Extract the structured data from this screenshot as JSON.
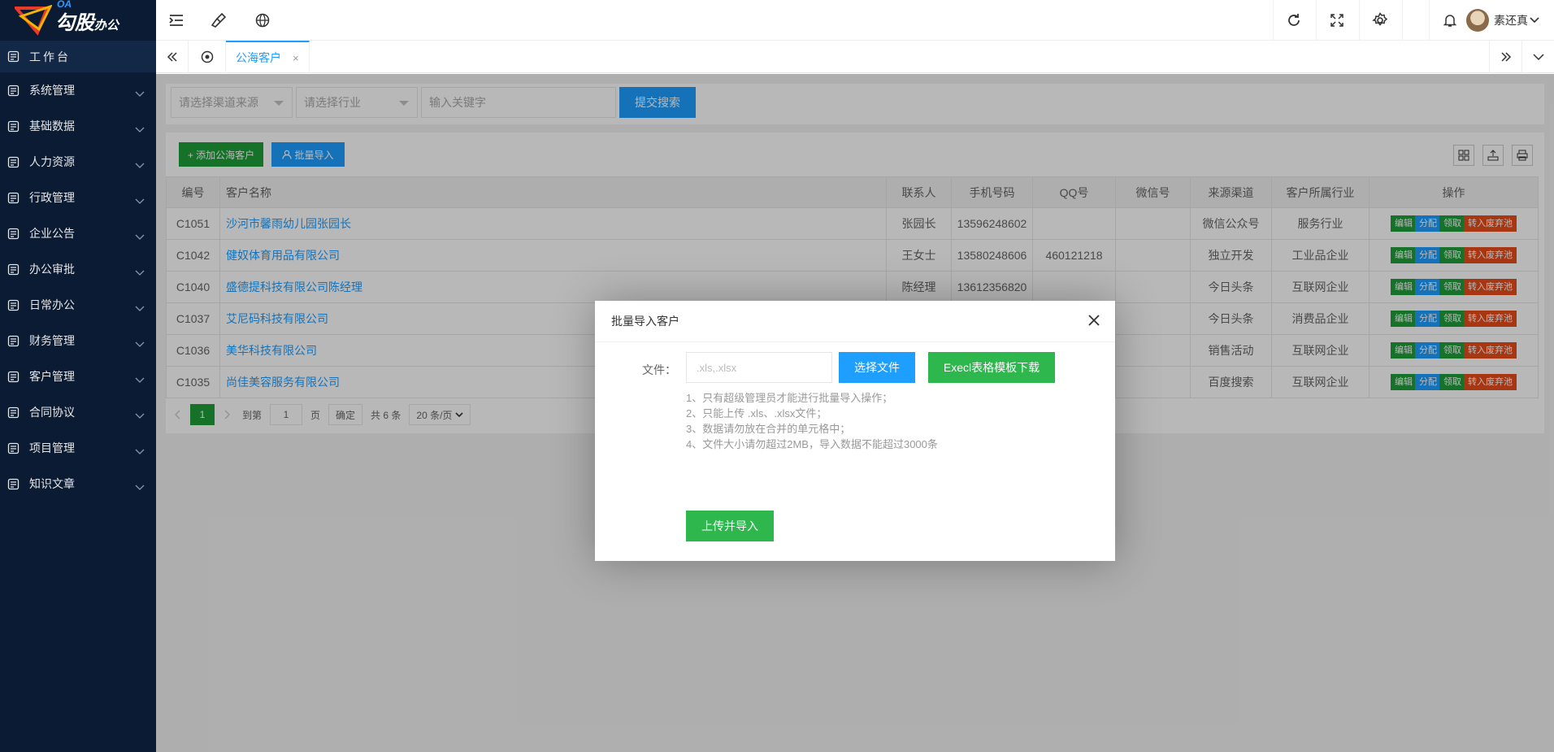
{
  "brand": {
    "oa": "OA",
    "name": "勾股",
    "suffix": "办公"
  },
  "sidebar": {
    "items": [
      {
        "label": "工作台",
        "icon": "dashboard-icon"
      },
      {
        "label": "系统管理",
        "icon": "settings-icon"
      },
      {
        "label": "基础数据",
        "icon": "data-icon"
      },
      {
        "label": "人力资源",
        "icon": "people-icon"
      },
      {
        "label": "行政管理",
        "icon": "admin-icon"
      },
      {
        "label": "企业公告",
        "icon": "bell-icon"
      },
      {
        "label": "办公审批",
        "icon": "approve-icon"
      },
      {
        "label": "日常办公",
        "icon": "calendar-icon"
      },
      {
        "label": "财务管理",
        "icon": "finance-icon"
      },
      {
        "label": "客户管理",
        "icon": "customer-icon"
      },
      {
        "label": "合同协议",
        "icon": "contract-icon"
      },
      {
        "label": "项目管理",
        "icon": "project-icon"
      },
      {
        "label": "知识文章",
        "icon": "article-icon"
      }
    ]
  },
  "topbar": {
    "user_name": "素还真"
  },
  "tabs": {
    "active_label": "公海客户",
    "close": "×"
  },
  "filters": {
    "channel_placeholder": "请选择渠道来源",
    "industry_placeholder": "请选择行业",
    "keyword_placeholder": "输入关键字",
    "search_label": "提交搜索"
  },
  "toolbar": {
    "add_label": "+ 添加公海客户",
    "import_label": "批量导入"
  },
  "table": {
    "headers": [
      "编号",
      "客户名称",
      "联系人",
      "手机号码",
      "QQ号",
      "微信号",
      "来源渠道",
      "客户所属行业",
      "操作"
    ],
    "rows": [
      {
        "id": "C1051",
        "name": "沙河市馨雨幼儿园张园长",
        "contact": "张园长",
        "phone": "13596248602",
        "qq": "",
        "wechat": "",
        "channel": "微信公众号",
        "industry": "服务行业"
      },
      {
        "id": "C1042",
        "name": "健奴体育用品有限公司",
        "contact": "王女士",
        "phone": "13580248606",
        "qq": "460121218",
        "wechat": "",
        "channel": "独立开发",
        "industry": "工业品企业"
      },
      {
        "id": "C1040",
        "name": "盛德提科技有限公司陈经理",
        "contact": "陈经理",
        "phone": "13612356820",
        "qq": "",
        "wechat": "",
        "channel": "今日头条",
        "industry": "互联网企业"
      },
      {
        "id": "C1037",
        "name": "艾尼码科技有限公司",
        "contact": "",
        "phone": "",
        "qq": "",
        "wechat": "",
        "channel": "今日头条",
        "industry": "消费品企业"
      },
      {
        "id": "C1036",
        "name": "美华科技有限公司",
        "contact": "",
        "phone": "",
        "qq": "",
        "wechat": "",
        "channel": "销售活动",
        "industry": "互联网企业"
      },
      {
        "id": "C1035",
        "name": "尚佳美容服务有限公司",
        "contact": "",
        "phone": "",
        "qq": "",
        "wechat": "",
        "channel": "百度搜索",
        "industry": "互联网企业"
      }
    ],
    "ops": {
      "edit": "编辑",
      "assign": "分配",
      "claim": "领取",
      "discard": "转入废弃池"
    }
  },
  "pager": {
    "current": "1",
    "goto_label": "到第",
    "page_value": "1",
    "page_unit": "页",
    "confirm": "确定",
    "total": "共 6 条",
    "per_page": "20 条/页"
  },
  "modal": {
    "title": "批量导入客户",
    "file_label": "文件：",
    "file_placeholder": ".xls,.xlsx",
    "choose_label": "选择文件",
    "template_label": "Execl表格模板下载",
    "notes": [
      "1、只有超级管理员才能进行批量导入操作；",
      "2、只能上传 .xls、.xlsx文件；",
      "3、数据请勿放在合并的单元格中；",
      "4、文件大小请勿超过2MB，导入数据不能超过3000条"
    ],
    "upload_label": "上传并导入"
  },
  "colors": {
    "primary": "#1e9fff",
    "green": "#1f9d3a",
    "danger": "#e84d1a",
    "sidebar": "#0b1b33"
  }
}
